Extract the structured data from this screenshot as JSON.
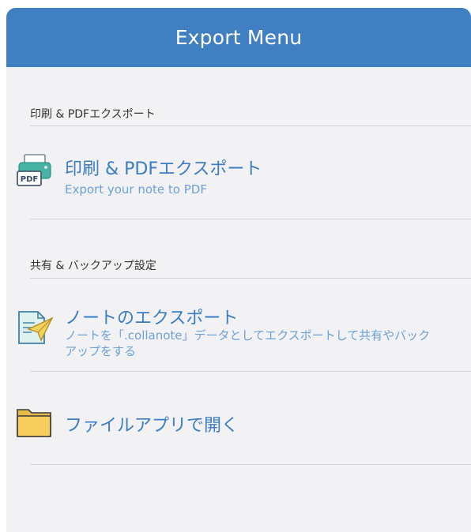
{
  "header": {
    "title": "Export Menu"
  },
  "sections": [
    {
      "header": "印刷 & PDFエクスポート",
      "items": [
        {
          "icon": "printer-pdf-icon",
          "title": "印刷 & PDFエクスポート",
          "subtitle": "Export your note to PDF"
        }
      ]
    },
    {
      "header": "共有 & バックアップ設定",
      "items": [
        {
          "icon": "paper-plane-document-icon",
          "title": "ノートのエクスポート",
          "subtitle": "ノートを「.collanote」データとしてエクスポートして共有やバックアップをする"
        },
        {
          "icon": "folder-icon",
          "title": "ファイルアプリで開く",
          "subtitle": ""
        }
      ]
    }
  ],
  "colors": {
    "header_background": "#3f7fc2",
    "accent_text": "#3b7cc4",
    "secondary_text": "#6ea0d8",
    "panel_background": "#f2f2f4"
  }
}
